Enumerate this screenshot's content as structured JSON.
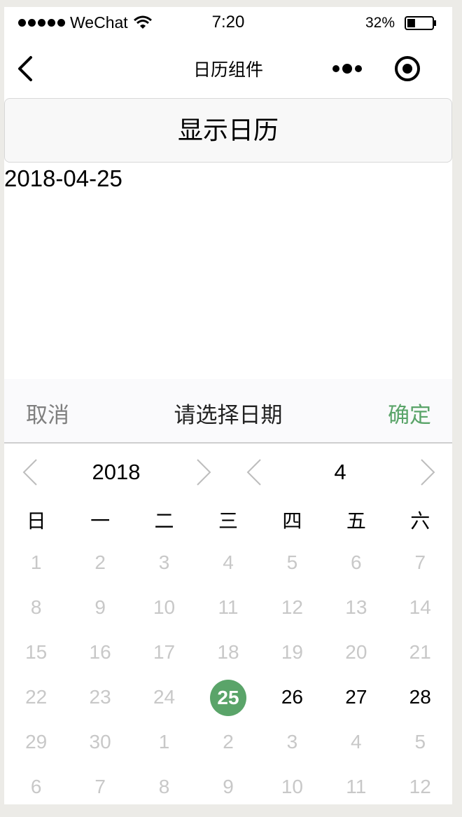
{
  "status": {
    "carrier": "WeChat",
    "time": "7:20",
    "battery": "32%",
    "battery_level": 0.32
  },
  "nav": {
    "title": "日历组件",
    "back_icon": "chevron-left-icon",
    "more_icon": "more-dots-icon",
    "close_icon": "target-icon"
  },
  "main": {
    "show_button": "显示日历",
    "selected_date": "2018-04-25"
  },
  "picker": {
    "cancel": "取消",
    "title": "请选择日期",
    "confirm": "确定",
    "year": "2018",
    "month": "4",
    "accent": "#5aa469",
    "weekdays": [
      "日",
      "一",
      "二",
      "三",
      "四",
      "五",
      "六"
    ],
    "weeks": [
      [
        "1",
        "2",
        "3",
        "4",
        "5",
        "6",
        "7"
      ],
      [
        "8",
        "9",
        "10",
        "11",
        "12",
        "13",
        "14"
      ],
      [
        "15",
        "16",
        "17",
        "18",
        "19",
        "20",
        "21"
      ],
      [
        "22",
        "23",
        "24",
        "25",
        "26",
        "27",
        "28"
      ],
      [
        "29",
        "30",
        "1",
        "2",
        "3",
        "4",
        "5"
      ],
      [
        "6",
        "7",
        "8",
        "9",
        "10",
        "11",
        "12"
      ]
    ],
    "selected_index": 24,
    "active_indices": [
      25,
      26,
      27
    ]
  }
}
